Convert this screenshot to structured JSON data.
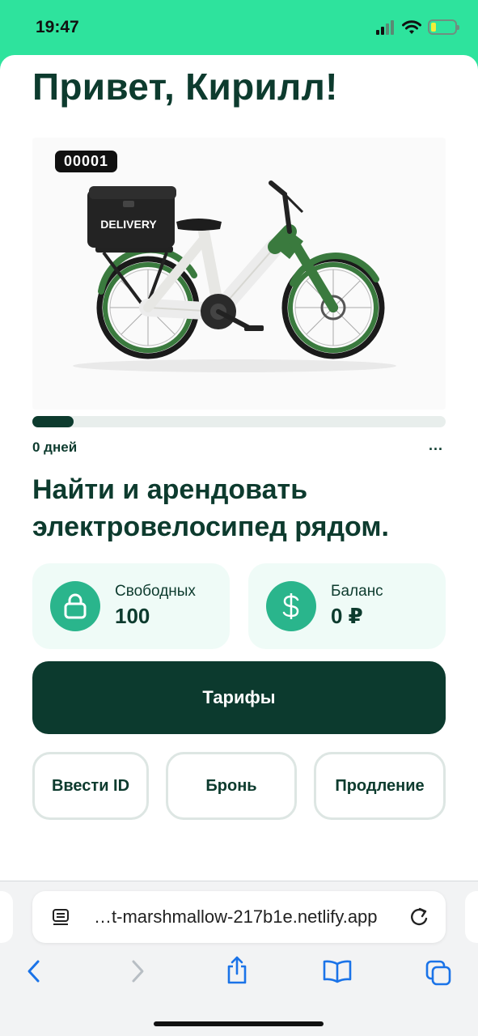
{
  "status_bar": {
    "time": "19:47",
    "icons": [
      "cellular-signal-icon",
      "wifi-icon",
      "battery-icon"
    ],
    "battery_level": 0.2
  },
  "app": {
    "greeting": "Привет, Кирилл!",
    "bike": {
      "id_badge": "00001",
      "box_label": "DELIVERY"
    },
    "rental_progress": 0.1,
    "days_label": "0 дней",
    "more_label": "...",
    "headline": "Найти и арендовать электровелосипед рядом.",
    "stats": {
      "free": {
        "label": "Свободных",
        "value": "100",
        "icon": "lock-icon"
      },
      "balance": {
        "label": "Баланс",
        "value": "0 ₽",
        "icon": "dollar-icon"
      }
    },
    "tariffs_button": "Тарифы",
    "actions": {
      "enter_id": "Ввести ID",
      "booking": "Бронь",
      "extension": "Продление"
    }
  },
  "browser": {
    "url": "…t-marshmallow-217b1e.netlify.app",
    "toolbar_icons": [
      "back-icon",
      "forward-icon",
      "share-icon",
      "bookmarks-icon",
      "tabs-icon"
    ]
  },
  "colors": {
    "status_bar_bg": "#2ee39d",
    "primary_dark": "#0c3a2e",
    "accent": "#2ab58c",
    "card_bg": "#effbf7"
  }
}
